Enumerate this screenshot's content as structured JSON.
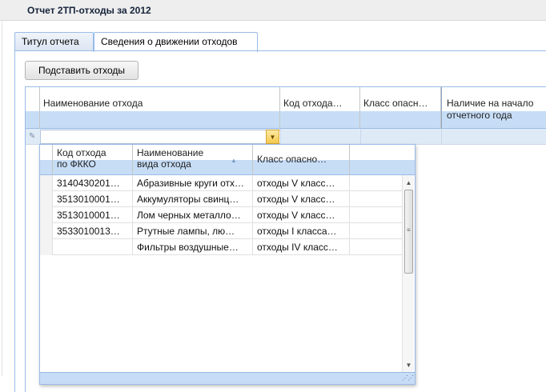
{
  "window": {
    "title": "Отчет 2ТП-отходы за 2012"
  },
  "tabs": [
    {
      "label": "Титул отчета",
      "active": false
    },
    {
      "label": "Сведения о движении отходов",
      "active": true
    }
  ],
  "toolbar": {
    "substitute_label": "Подставить отходы"
  },
  "grid": {
    "columns": [
      {
        "label": ""
      },
      {
        "label": "Наименование отхода"
      },
      {
        "label": "Код отхода…"
      },
      {
        "label": "Класс опасн…"
      },
      {
        "label": "Наличие на начало отчетного года"
      }
    ],
    "edit_row": {
      "combo_value": ""
    }
  },
  "dropdown": {
    "columns": [
      {
        "label": ""
      },
      {
        "label": "Код отхода\nпо ФККО"
      },
      {
        "label": "Наименование\nвида отхода"
      },
      {
        "label": "Класс опасно…"
      },
      {
        "label": ""
      }
    ],
    "sorted_column": "Наименование вида отхода",
    "rows": [
      {
        "code": "3140430201…",
        "name": "Абразивные круги отх…",
        "class": "отходы V класс…"
      },
      {
        "code": "3513010001…",
        "name": "Аккумуляторы свинц…",
        "class": "отходы V класс…"
      },
      {
        "code": "3513010001…",
        "name": "Лом черных металло…",
        "class": "отходы V класс…"
      },
      {
        "code": "3533010013…",
        "name": "Ртутные лампы, лю…",
        "class": "отходы I класса…"
      },
      {
        "code": "",
        "name": "Фильтры воздушные…",
        "class": "отходы IV класс…"
      }
    ]
  },
  "icons": {
    "edit": "pencil-icon",
    "combo_trigger": "chevron-down-icon",
    "sort": "sort-ascending-icon",
    "scroll_up": "arrow-up-icon",
    "scroll_down": "arrow-down-icon",
    "resize": "resize-grip-icon"
  },
  "colors": {
    "header_band": "#c7ddf6",
    "border": "#99bbe8",
    "combo_trigger": "#f5c94f"
  }
}
